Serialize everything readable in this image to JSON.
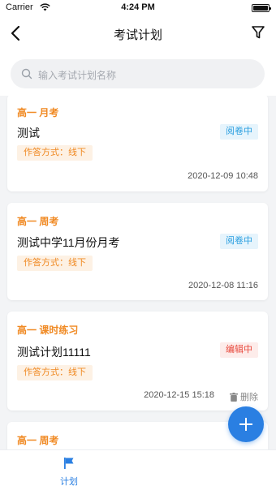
{
  "status_bar": {
    "carrier": "Carrier",
    "time": "4:24 PM"
  },
  "nav": {
    "title": "考试计划"
  },
  "search": {
    "placeholder": "输入考试计划名称"
  },
  "cards": [
    {
      "grade": "高一  月考",
      "name": "测试",
      "mode": "作答方式：线下",
      "status": "阅卷中",
      "date": "2020-12-09 10:48"
    },
    {
      "grade": "高一  周考",
      "name": "测试中学11月份月考",
      "mode": "作答方式：线下",
      "status": "阅卷中",
      "date": "2020-12-08 11:16"
    },
    {
      "grade": "高一  课时练习",
      "name": "测试计划11111",
      "mode": "作答方式：线下",
      "status": "编辑中",
      "date": "2020-12-15 15:18",
      "delete": "删除"
    },
    {
      "grade": "高一  周考"
    }
  ],
  "tab_bar": {
    "items": [
      {
        "label": "计划",
        "icon": "flag-icon",
        "active": true
      }
    ]
  },
  "colors": {
    "accent": "#2a7fe2",
    "orange": "#f08a24",
    "reading": "#2b9fe0",
    "editing": "#e8493d"
  }
}
